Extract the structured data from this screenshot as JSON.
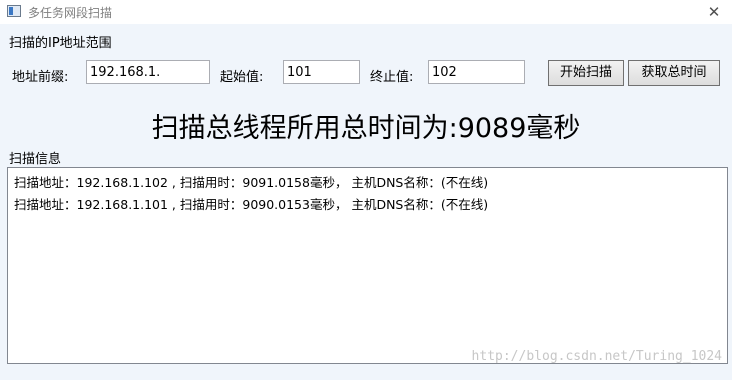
{
  "window": {
    "title": "多任务网段扫描",
    "close_symbol": "✕"
  },
  "range_group": {
    "label": "扫描的IP地址范围",
    "prefix_label": "地址前缀:",
    "prefix_value": "192.168.1.",
    "start_label": "起始值:",
    "start_value": "101",
    "end_label": "终止值:",
    "end_value": "102"
  },
  "buttons": {
    "start_scan": "开始扫描",
    "get_total_time": "获取总时间"
  },
  "total_time_text": "扫描总线程所用总时间为:9089毫秒",
  "info_group": {
    "label": "扫描信息",
    "lines": [
      "扫描地址：192.168.1.102 , 扫描用时：9091.0158毫秒， 主机DNS名称：(不在线)",
      "扫描地址：192.168.1.101 , 扫描用时：9090.0153毫秒， 主机DNS名称：(不在线)"
    ]
  },
  "watermark": "http://blog.csdn.net/Turing_1024"
}
